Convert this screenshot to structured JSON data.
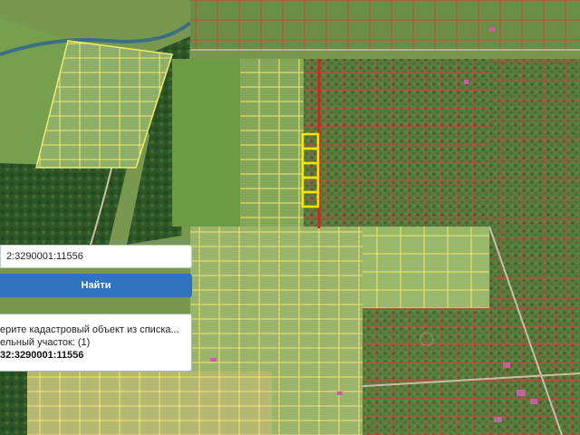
{
  "colors": {
    "field_green": "#7c9a58",
    "forest": "#2f5a2a",
    "yellow_grid": "#f2ea6a",
    "red_grid": "#c94a3e",
    "selected": "#ffe600",
    "boundary_red": "#e01c1c",
    "button_blue": "#2f73bf"
  },
  "search": {
    "value": "2:3290001:11556"
  },
  "find_button": {
    "label": "Найти"
  },
  "results": {
    "prompt": "ерите кадастровый объект из списка...",
    "category": "ельный участок: (1)",
    "item": "32:3290001:11556"
  },
  "map": {
    "icons": [
      "search-icon"
    ]
  }
}
